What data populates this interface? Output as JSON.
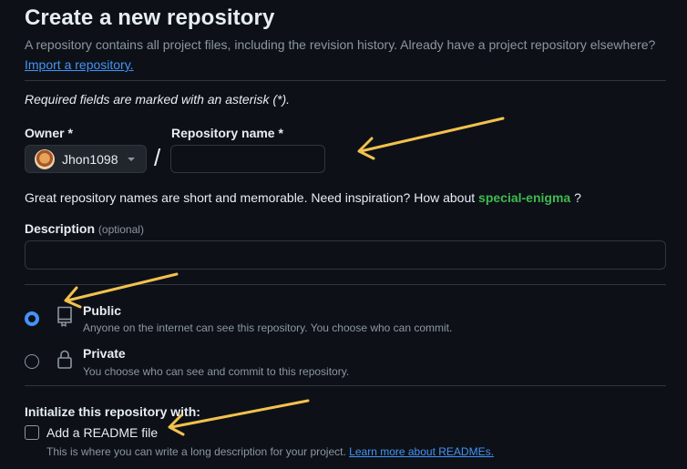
{
  "header": {
    "title": "Create a new repository",
    "subtitle": "A repository contains all project files, including the revision history. Already have a project repository elsewhere?",
    "import_link": "Import a repository."
  },
  "form": {
    "required_note": "Required fields are marked with an asterisk (*).",
    "owner": {
      "label": "Owner *",
      "value": "Jhon1098"
    },
    "separator": "/",
    "repo_name": {
      "label": "Repository name *",
      "value": "",
      "placeholder": ""
    },
    "name_hint": {
      "prefix": "Great repository names are short and memorable. Need inspiration? How about",
      "suggestion": "special-enigma",
      "suffix": "?"
    },
    "description": {
      "label": "Description",
      "optional": "(optional)",
      "value": "",
      "placeholder": ""
    },
    "visibility": {
      "selected": "Public",
      "options": [
        {
          "title": "Public",
          "description": "Anyone on the internet can see this repository. You choose who can commit.",
          "icon": "repo-icon"
        },
        {
          "title": "Private",
          "description": "You choose who can see and commit to this repository.",
          "icon": "lock-icon"
        }
      ]
    },
    "initialize": {
      "heading": "Initialize this repository with:",
      "readme_label": "Add a README file",
      "readme_checked": false,
      "readme_desc": "This is where you can write a long description for your project.",
      "readme_link": "Learn more about READMEs."
    }
  },
  "colors": {
    "background": "#0d1117",
    "accent_blue": "#4493f8",
    "suggest_green": "#3fb950",
    "annotation_arrow": "#f2c14e"
  }
}
